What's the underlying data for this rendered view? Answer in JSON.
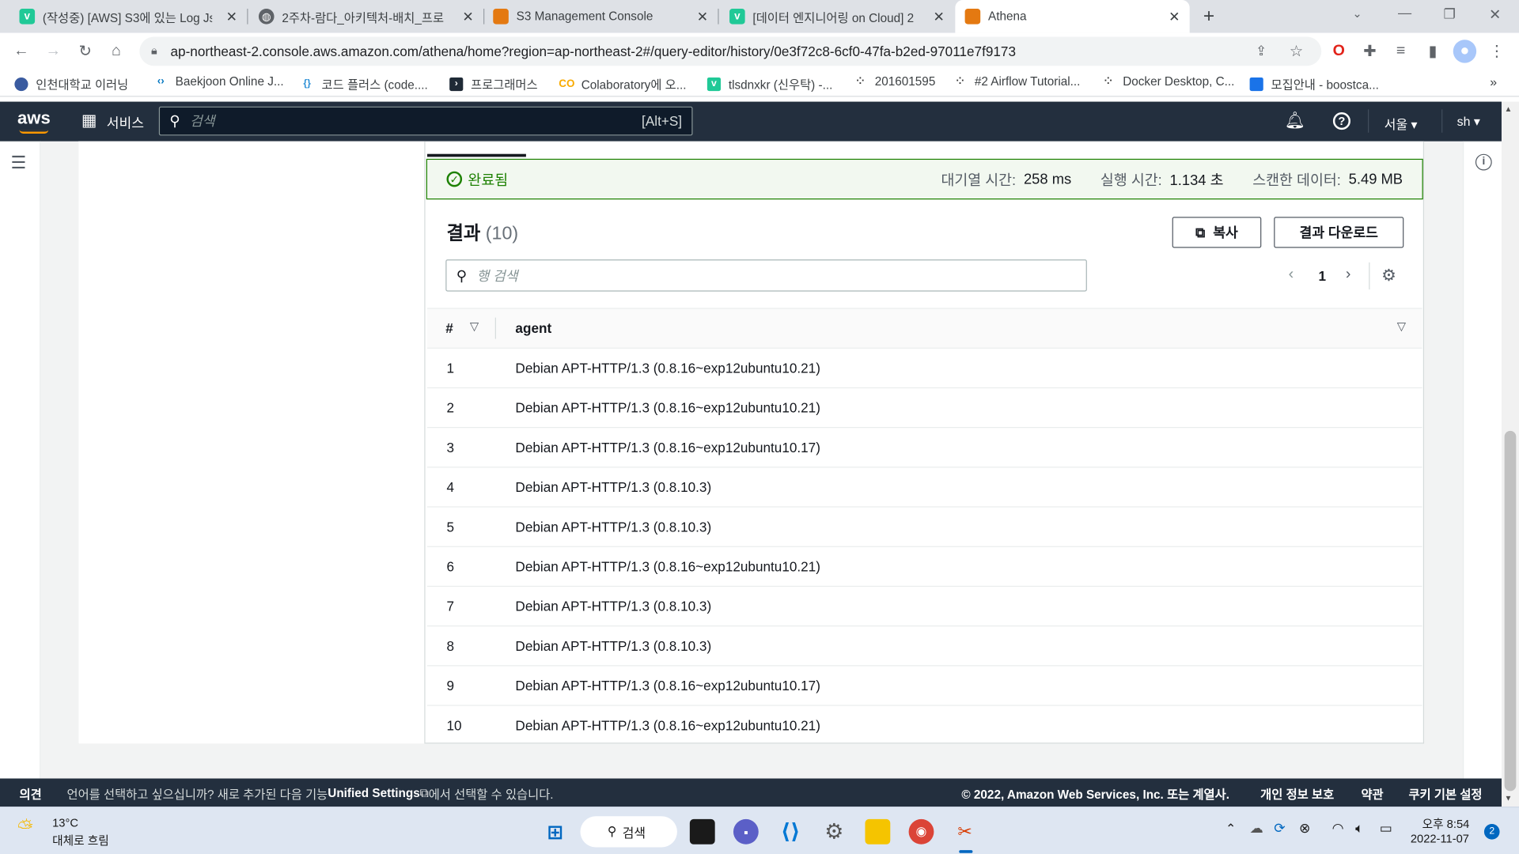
{
  "tabs": [
    {
      "title": "(작성중) [AWS] S3에 있는 Log Js",
      "icon": "velog-icon"
    },
    {
      "title": "2주차-람다_아키텍처-배치_프로",
      "icon": "globe-icon"
    },
    {
      "title": "S3 Management Console",
      "icon": "aws-s3-icon"
    },
    {
      "title": "[데이터 엔지니어링 on Cloud] 2",
      "icon": "velog-icon"
    },
    {
      "title": "Athena",
      "icon": "aws-athena-icon"
    }
  ],
  "browser": {
    "url": "ap-northeast-2.console.aws.amazon.com/athena/home?region=ap-northeast-2#/query-editor/history/0e3f72c8-6cf0-47fa-b2ed-97011e7f9173"
  },
  "bookmarks": [
    "인천대학교 이러닝",
    "Baekjoon Online J...",
    "코드 플러스 (code....",
    "프로그래머스",
    "Colaboratory에 오...",
    "tlsdnxkr (신우탁) -...",
    "201601595",
    "#2 Airflow Tutorial...",
    "Docker Desktop, C...",
    "모집안내 - boostca..."
  ],
  "aws": {
    "logo": "aws",
    "services": "서비스",
    "search_placeholder": "검색",
    "search_shortcut": "[Alt+S]",
    "region": "서울",
    "user": "sh"
  },
  "status": {
    "state": "완료됨",
    "queue_label": "대기열 시간:",
    "queue_value": "258 ms",
    "run_label": "실행 시간:",
    "run_value": "1.134 초",
    "scan_label": "스캔한 데이터:",
    "scan_value": "5.49 MB"
  },
  "results": {
    "title": "결과",
    "count": "(10)",
    "copy_label": "복사",
    "download_label": "결과 다운로드",
    "row_search_placeholder": "행 검색",
    "page": "1",
    "col_num": "#",
    "col_agent": "agent",
    "rows": [
      {
        "n": "1",
        "agent": "Debian APT-HTTP/1.3 (0.8.16~exp12ubuntu10.21)"
      },
      {
        "n": "2",
        "agent": "Debian APT-HTTP/1.3 (0.8.16~exp12ubuntu10.21)"
      },
      {
        "n": "3",
        "agent": "Debian APT-HTTP/1.3 (0.8.16~exp12ubuntu10.17)"
      },
      {
        "n": "4",
        "agent": "Debian APT-HTTP/1.3 (0.8.10.3)"
      },
      {
        "n": "5",
        "agent": "Debian APT-HTTP/1.3 (0.8.10.3)"
      },
      {
        "n": "6",
        "agent": "Debian APT-HTTP/1.3 (0.8.16~exp12ubuntu10.21)"
      },
      {
        "n": "7",
        "agent": "Debian APT-HTTP/1.3 (0.8.10.3)"
      },
      {
        "n": "8",
        "agent": "Debian APT-HTTP/1.3 (0.8.10.3)"
      },
      {
        "n": "9",
        "agent": "Debian APT-HTTP/1.3 (0.8.16~exp12ubuntu10.17)"
      },
      {
        "n": "10",
        "agent": "Debian APT-HTTP/1.3 (0.8.16~exp12ubuntu10.21)"
      }
    ]
  },
  "footer": {
    "feedback": "의견",
    "lang_msg_a": "언어를 선택하고 싶으십니까? 새로 추가된 다음 기능",
    "unified": "Unified Settings",
    "lang_msg_b": "에서 선택할 수 있습니다.",
    "copyright": "© 2022, Amazon Web Services, Inc. 또는 계열사.",
    "privacy": "개인 정보 보호",
    "terms": "약관",
    "cookies": "쿠키 기본 설정"
  },
  "taskbar": {
    "temp": "13°C",
    "weather": "대체로 흐림",
    "search": "검색",
    "time": "오후 8:54",
    "date": "2022-11-07",
    "notif": "2"
  },
  "colors": {
    "aws_header": "#232f3e",
    "success_green": "#1d8102",
    "link_blue": "#0073bb"
  }
}
